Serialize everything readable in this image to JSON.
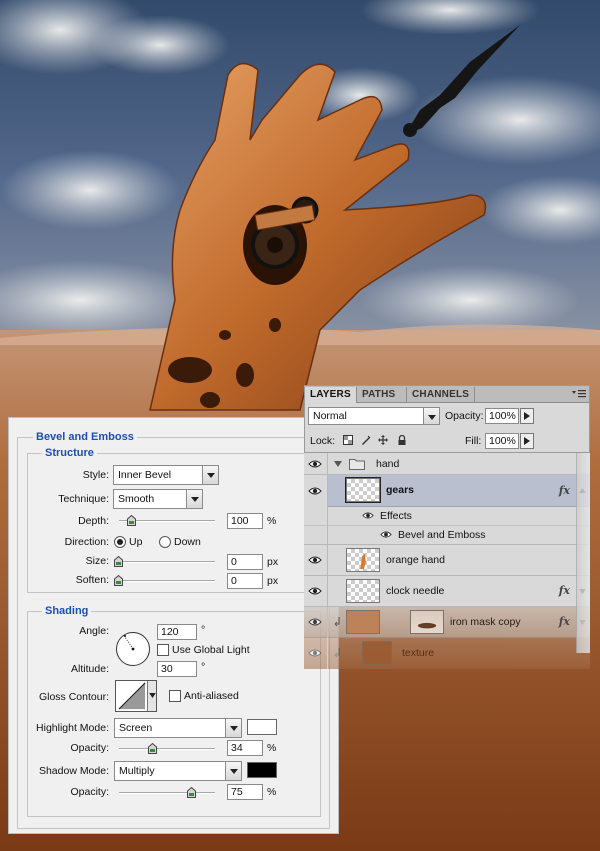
{
  "bevel": {
    "title": "Bevel and Emboss",
    "structure": {
      "title": "Structure",
      "style_label": "Style:",
      "style_value": "Inner Bevel",
      "technique_label": "Technique:",
      "technique_value": "Smooth",
      "depth_label": "Depth:",
      "depth_value": "100",
      "depth_unit": "%",
      "depth_level": 0.09,
      "direction_label": "Direction:",
      "direction_up": "Up",
      "direction_down": "Down",
      "direction_selected": "Up",
      "size_label": "Size:",
      "size_value": "0",
      "size_unit": "px",
      "soften_label": "Soften:",
      "soften_value": "0",
      "soften_unit": "px"
    },
    "shading": {
      "title": "Shading",
      "angle_label": "Angle:",
      "angle_value": "120",
      "angle_unit": "°",
      "use_global_light": "Use Global Light",
      "altitude_label": "Altitude:",
      "altitude_value": "30",
      "altitude_unit": "°",
      "gloss_contour_label": "Gloss Contour:",
      "anti_aliased": "Anti-aliased",
      "highlight_mode_label": "Highlight Mode:",
      "highlight_mode_value": "Screen",
      "highlight_color": "#ffffff",
      "highlight_opacity_label": "Opacity:",
      "highlight_opacity_value": "34",
      "highlight_opacity_unit": "%",
      "shadow_mode_label": "Shadow Mode:",
      "shadow_mode_value": "Multiply",
      "shadow_color": "#000000",
      "shadow_opacity_label": "Opacity:",
      "shadow_opacity_value": "75",
      "shadow_opacity_unit": "%"
    }
  },
  "layers": {
    "tabs": [
      "LAYERS",
      "PATHS",
      "CHANNELS"
    ],
    "blend_mode": "Normal",
    "opacity_label": "Opacity:",
    "opacity_value": "100%",
    "lock_label": "Lock:",
    "fill_label": "Fill:",
    "fill_value": "100%",
    "fx_label": "fx",
    "items": [
      {
        "name": "hand",
        "type": "group"
      },
      {
        "name": "gears",
        "type": "layer",
        "selected": true
      },
      {
        "name": "Effects",
        "type": "effects"
      },
      {
        "name": "Bevel and Emboss",
        "type": "effect"
      },
      {
        "name": "orange hand",
        "type": "layer"
      },
      {
        "name": "clock needle",
        "type": "layer"
      },
      {
        "name": "iron mask copy",
        "type": "layer"
      },
      {
        "name": "texture",
        "type": "layer"
      }
    ]
  },
  "colors": {
    "accent": "#1a4fb5",
    "selected_row": "#b9bfcf"
  }
}
